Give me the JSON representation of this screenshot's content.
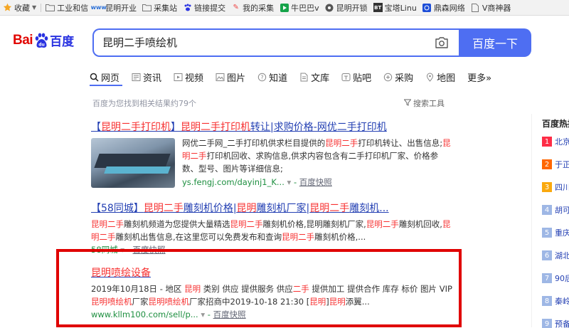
{
  "bookmarks": [
    {
      "label": "收藏",
      "icon": "star-icon"
    },
    {
      "label": "工业和信",
      "icon": "folder-icon"
    },
    {
      "label": "昆明开业",
      "icon": "site-icon"
    },
    {
      "label": "采集站",
      "icon": "folder-icon"
    },
    {
      "label": "链接提交",
      "icon": "paw-icon"
    },
    {
      "label": "我的采集",
      "icon": "tool-icon"
    },
    {
      "label": "牛巴巴v",
      "icon": "play-icon"
    },
    {
      "label": "昆明开锁",
      "icon": "lock-icon"
    },
    {
      "label": "宝塔Linu",
      "icon": "bt-icon"
    },
    {
      "label": "鼎森网络",
      "icon": "globe-icon"
    },
    {
      "label": "V商神器",
      "icon": "doc-icon"
    }
  ],
  "logo": {
    "left": "Bai",
    "right": "百度"
  },
  "search": {
    "query": "昆明二手喷绘机",
    "button": "百度一下"
  },
  "tabs": [
    {
      "label": "网页",
      "icon": "search-icon"
    },
    {
      "label": "资讯",
      "icon": "news-icon"
    },
    {
      "label": "视频",
      "icon": "video-icon"
    },
    {
      "label": "图片",
      "icon": "image-icon"
    },
    {
      "label": "知道",
      "icon": "question-icon"
    },
    {
      "label": "文库",
      "icon": "doc-icon"
    },
    {
      "label": "贴吧",
      "icon": "tieba-icon"
    },
    {
      "label": "采购",
      "icon": "cart-icon"
    },
    {
      "label": "地图",
      "icon": "map-icon"
    },
    {
      "label": "更多»",
      "icon": ""
    }
  ],
  "result_count": "百度为您找到相关结果约79个",
  "search_tools": "搜索工具",
  "results": [
    {
      "title_parts": [
        "【",
        "昆明二手打印机",
        "】",
        "昆明二手打印机",
        "转让|求购价格-网优二手打印机"
      ],
      "abstract_parts": [
        "网优二手网_二手打印机供求栏目提供的",
        "昆明二手",
        "打印机转让、出售信息;",
        "昆明二手",
        "打印机回收、求购信息,供求内容包含有二手打印机厂家、价格参数、型号、图片等详细信息;"
      ],
      "url": "ys.fengj.com/dayinj1_K...",
      "snapshot": "百度快照"
    },
    {
      "title_parts": [
        "【58同城】",
        "昆明二手",
        "雕刻机价格|",
        "昆明",
        "雕刻机厂家|",
        "昆明二手",
        "雕刻机..."
      ],
      "abstract_parts": [
        "昆明二手",
        "雕刻机频道为您提供大量精选",
        "昆明二手",
        "雕刻机价格,昆明雕刻机厂家,",
        "昆明二手",
        "雕刻机回收,",
        "昆明二手",
        "雕刻机出售信息,在这里您可以免费发布和查询",
        "昆明二手",
        "雕刻机价格,..."
      ],
      "url": "58同城",
      "snapshot": "百度快照"
    },
    {
      "title_parts": [
        "昆明喷绘设备"
      ],
      "abstract_parts": [
        "2019年10月18日 - 地区 ",
        "昆明",
        " 类别 供应 提供服务 供应",
        "二手",
        " 提供加工 提供合作 库存 标价 图片 VIP ",
        "昆明喷绘机",
        "厂家",
        "昆明喷绘机",
        "厂家招商中2019-10-18 21:30 [",
        "昆明",
        "]",
        "昆明",
        "添翼..."
      ],
      "url": "www.kllm100.com/sell/p...",
      "snapshot": "百度快照"
    }
  ],
  "hot": {
    "title": "百度热搜",
    "items": [
      {
        "num": "1",
        "text": "北京",
        "color": "#fe2d46"
      },
      {
        "num": "2",
        "text": "于正",
        "color": "#f60"
      },
      {
        "num": "3",
        "text": "四川",
        "color": "#faa90e"
      },
      {
        "num": "4",
        "text": "胡可",
        "color": "#9eb7e5"
      },
      {
        "num": "5",
        "text": "重庆",
        "color": "#9eb7e5"
      },
      {
        "num": "6",
        "text": "湖北",
        "color": "#9eb7e5"
      },
      {
        "num": "7",
        "text": "90后",
        "color": "#9eb7e5"
      },
      {
        "num": "8",
        "text": "秦岭",
        "color": "#9eb7e5"
      },
      {
        "num": "9",
        "text": "预备",
        "color": "#9eb7e5"
      }
    ]
  },
  "colors": {
    "accent": "#4e6ef2",
    "highlight": "#f73131",
    "link": "#2440b3",
    "url": "#1e8f40",
    "annotation": "#e00000"
  }
}
